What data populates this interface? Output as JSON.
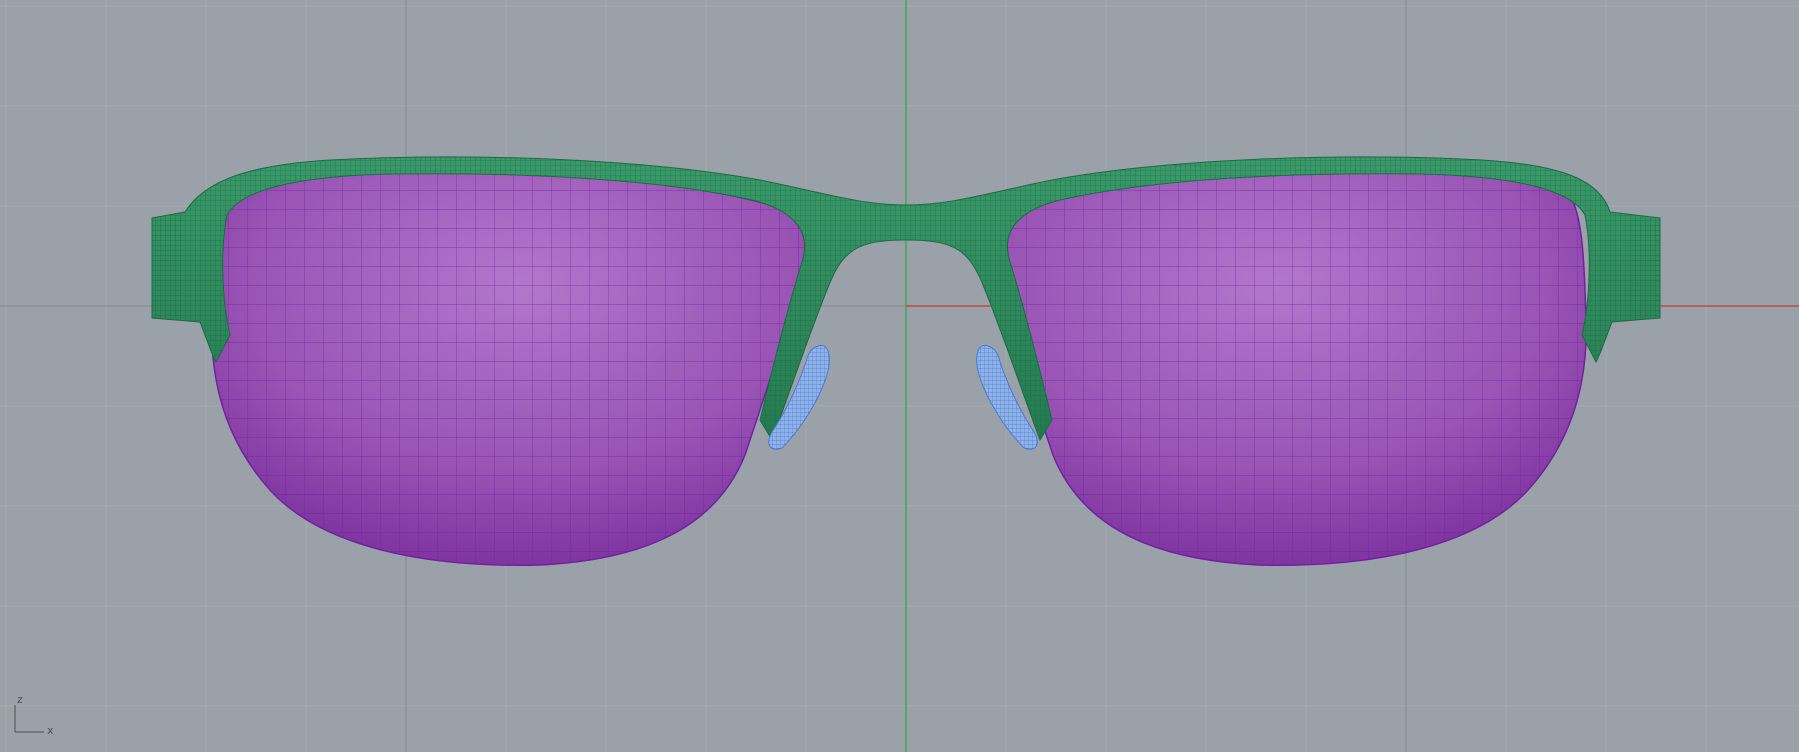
{
  "viewport": {
    "projection": "Front",
    "background": "#9aa1a8",
    "grid": true,
    "colors": {
      "grid_minor": "#a8aeb4",
      "grid_major": "#848a91",
      "axis_z": "#34a844",
      "axis_x": "#c23a36",
      "frame": "#2e8a5c",
      "frame_wire": "#1c6b44",
      "lens": "#9c58b6",
      "lens_wire": "#6f22a0",
      "nose_pad": "#8fb3e8",
      "nose_pad_wire": "#4b7bd1"
    }
  },
  "model": {
    "objects": [
      {
        "name": "frame",
        "color": "frame"
      },
      {
        "name": "lens-left",
        "color": "lens"
      },
      {
        "name": "lens-right",
        "color": "lens"
      },
      {
        "name": "nose-pad-left",
        "color": "nose_pad"
      },
      {
        "name": "nose-pad-right",
        "color": "nose_pad"
      }
    ]
  },
  "axis_widget": {
    "vertical_label": "z",
    "horizontal_label": "x"
  }
}
